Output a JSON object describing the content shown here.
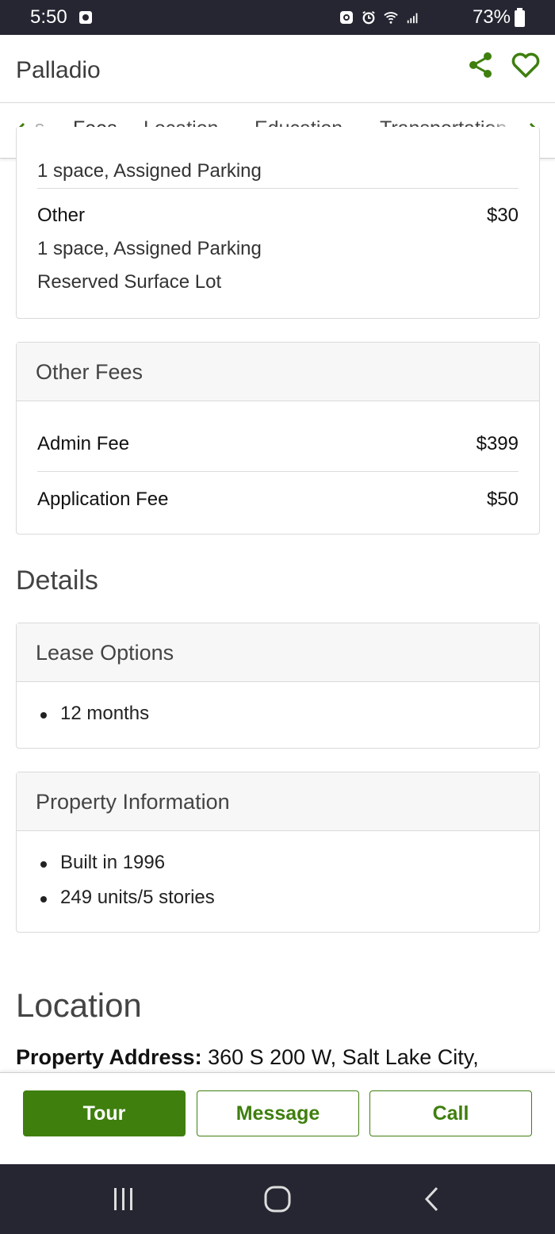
{
  "status_bar": {
    "time": "5:50",
    "battery": "73%"
  },
  "header": {
    "title": "Palladio",
    "accent_color": "#3f7f0e",
    "share_icon": "share-icon",
    "favorite_icon": "heart-icon"
  },
  "tabs": {
    "clipped_left": "s",
    "items": [
      {
        "label": "Fees",
        "active": true
      },
      {
        "label": "Location",
        "active": false
      },
      {
        "label": "Education",
        "active": false
      },
      {
        "label": "Transportation",
        "active": false
      }
    ]
  },
  "parking_card": {
    "clipped_sub": "1 space, Assigned Parking",
    "rows": [
      {
        "label": "Other",
        "value": "$30",
        "sub1": "1 space, Assigned Parking",
        "sub2": "Reserved Surface Lot"
      }
    ]
  },
  "other_fees": {
    "title": "Other Fees",
    "rows": [
      {
        "label": "Admin Fee",
        "value": "$399"
      },
      {
        "label": "Application Fee",
        "value": "$50"
      }
    ]
  },
  "details": {
    "heading": "Details",
    "lease_options": {
      "title": "Lease Options",
      "items": [
        "12 months"
      ]
    },
    "property_info": {
      "title": "Property Information",
      "items": [
        "Built in 1996",
        "249 units/5 stories"
      ]
    }
  },
  "location": {
    "heading": "Location",
    "address_label": "Property Address:",
    "address_value": "360 S 200 W, Salt Lake City,"
  },
  "actions": {
    "tour": "Tour",
    "message": "Message",
    "call": "Call"
  }
}
